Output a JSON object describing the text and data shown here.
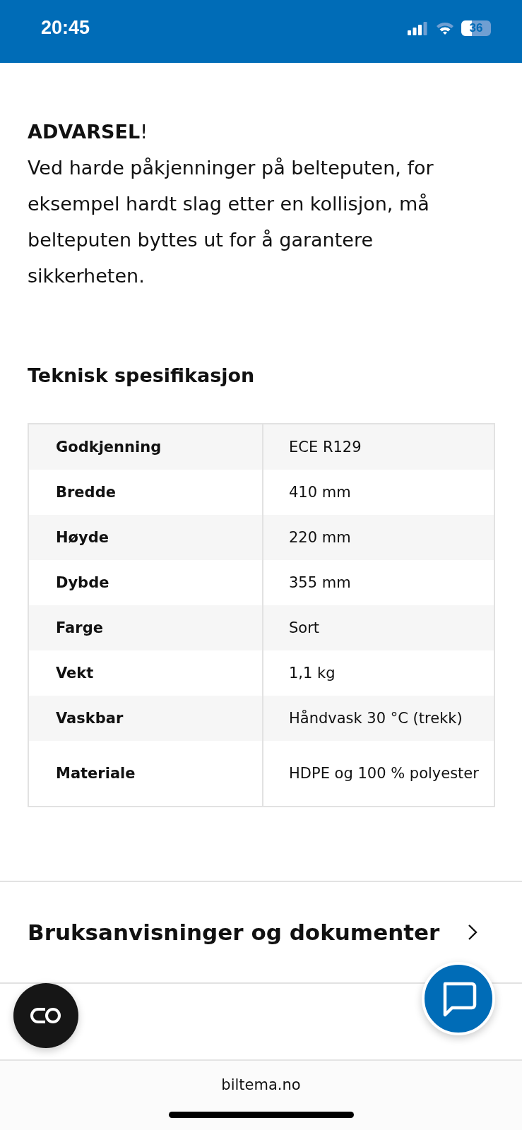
{
  "status_bar": {
    "time": "20:45",
    "battery": "36"
  },
  "warning": {
    "title": "**ADVARSEL**!",
    "text": "Ved harde påkjenninger på belteputen, for eksempel hardt slag etter en kollisjon, må belteputen byttes ut for å garantere sikkerheten."
  },
  "spec": {
    "heading": "Teknisk spesifikasjon",
    "rows": [
      {
        "label": "Godkjenning",
        "value": "ECE R129"
      },
      {
        "label": "Bredde",
        "value": "410 mm"
      },
      {
        "label": "Høyde",
        "value": "220 mm"
      },
      {
        "label": "Dybde",
        "value": "355 mm"
      },
      {
        "label": "Farge",
        "value": "Sort"
      },
      {
        "label": "Vekt",
        "value": "1,1 kg"
      },
      {
        "label": "Vaskbar",
        "value": "Håndvask 30 °C (trekk)"
      },
      {
        "label": "Materiale",
        "value": "HDPE og 100 % polyester"
      }
    ]
  },
  "documents_link": {
    "label": "Bruksanvisninger og dokumenter"
  },
  "browser_bar": {
    "url": "biltema.no"
  }
}
